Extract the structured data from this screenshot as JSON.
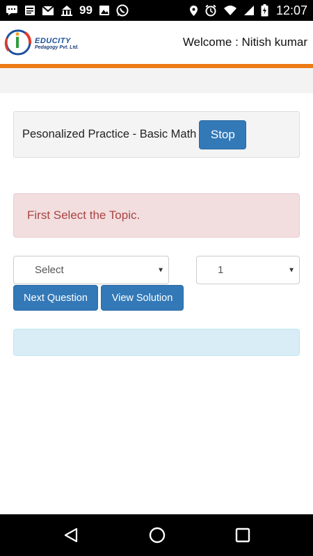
{
  "status_bar": {
    "notification_count": "99",
    "time": "12:07",
    "icons": [
      "message-icon",
      "news-icon",
      "gmail-icon",
      "temple-icon",
      "image-icon",
      "whatsapp-icon",
      "location-icon",
      "alarm-icon",
      "wifi-icon",
      "signal-icon",
      "battery-icon"
    ]
  },
  "header": {
    "logo_brand": "EDUCITY",
    "logo_subtitle": "Pedagogy Pvt. Ltd.",
    "welcome_text": "Welcome : Nitish kumar"
  },
  "practice": {
    "title": "Pesonalized Practice - Basic Math",
    "stop_label": "Stop"
  },
  "alert": {
    "message": "First Select the Topic."
  },
  "controls": {
    "topic_select_value": "Select",
    "count_select_value": "1",
    "next_label": "Next Question",
    "solution_label": "View Solution"
  },
  "colors": {
    "accent_orange": "#ec7a16",
    "button_blue": "#3379b8",
    "alert_bg": "#f2dedf",
    "alert_text": "#a94442",
    "info_bg": "#d9edf7"
  },
  "nav_bar": {
    "icons": [
      "back-icon",
      "home-icon",
      "recents-icon"
    ]
  }
}
